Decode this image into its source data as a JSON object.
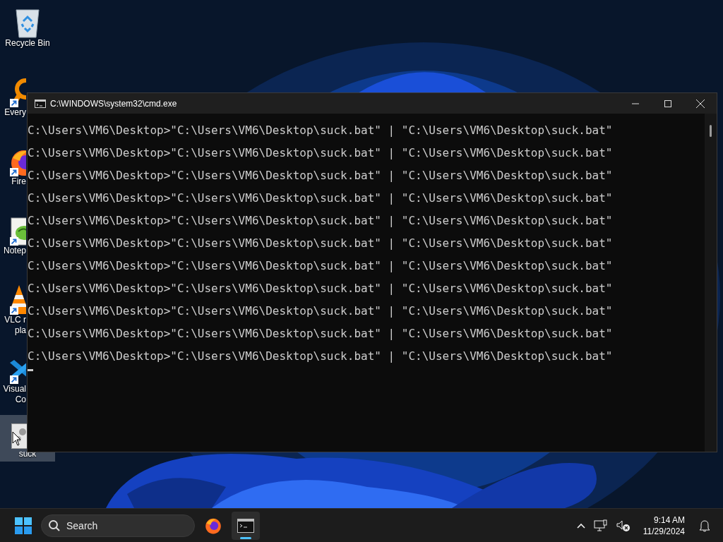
{
  "desktop": {
    "icons": [
      {
        "kind": "recycle",
        "label_lines": [
          "Recycle Bin"
        ],
        "shortcut": false,
        "selected": false
      },
      {
        "kind": "everything",
        "label_lines": [
          "Every"
        ],
        "shortcut": true,
        "selected": false
      },
      {
        "kind": "firefox",
        "label_lines": [
          "Fire"
        ],
        "shortcut": true,
        "selected": false
      },
      {
        "kind": "notepad",
        "label_lines": [
          "Notep"
        ],
        "shortcut": true,
        "selected": false
      },
      {
        "kind": "vlc",
        "label_lines": [
          "VLC r",
          "pla"
        ],
        "shortcut": true,
        "selected": false
      },
      {
        "kind": "vscode",
        "label_lines": [
          "Visual",
          "Co"
        ],
        "shortcut": true,
        "selected": false
      },
      {
        "kind": "batch",
        "label_lines": [
          "suck"
        ],
        "shortcut": false,
        "selected": true
      }
    ]
  },
  "window": {
    "title": "C:\\WINDOWS\\system32\\cmd.exe",
    "lines": [
      "C:\\Users\\VM6\\Desktop>\"C:\\Users\\VM6\\Desktop\\suck.bat\" | \"C:\\Users\\VM6\\Desktop\\suck.bat\"",
      "C:\\Users\\VM6\\Desktop>\"C:\\Users\\VM6\\Desktop\\suck.bat\" | \"C:\\Users\\VM6\\Desktop\\suck.bat\"",
      "C:\\Users\\VM6\\Desktop>\"C:\\Users\\VM6\\Desktop\\suck.bat\" | \"C:\\Users\\VM6\\Desktop\\suck.bat\"",
      "C:\\Users\\VM6\\Desktop>\"C:\\Users\\VM6\\Desktop\\suck.bat\" | \"C:\\Users\\VM6\\Desktop\\suck.bat\"",
      "C:\\Users\\VM6\\Desktop>\"C:\\Users\\VM6\\Desktop\\suck.bat\" | \"C:\\Users\\VM6\\Desktop\\suck.bat\"",
      "C:\\Users\\VM6\\Desktop>\"C:\\Users\\VM6\\Desktop\\suck.bat\" | \"C:\\Users\\VM6\\Desktop\\suck.bat\"",
      "C:\\Users\\VM6\\Desktop>\"C:\\Users\\VM6\\Desktop\\suck.bat\" | \"C:\\Users\\VM6\\Desktop\\suck.bat\"",
      "C:\\Users\\VM6\\Desktop>\"C:\\Users\\VM6\\Desktop\\suck.bat\" | \"C:\\Users\\VM6\\Desktop\\suck.bat\"",
      "C:\\Users\\VM6\\Desktop>\"C:\\Users\\VM6\\Desktop\\suck.bat\" | \"C:\\Users\\VM6\\Desktop\\suck.bat\"",
      "C:\\Users\\VM6\\Desktop>\"C:\\Users\\VM6\\Desktop\\suck.bat\" | \"C:\\Users\\VM6\\Desktop\\suck.bat\"",
      "C:\\Users\\VM6\\Desktop>\"C:\\Users\\VM6\\Desktop\\suck.bat\" | \"C:\\Users\\VM6\\Desktop\\suck.bat\""
    ]
  },
  "taskbar": {
    "search": {
      "placeholder": "Search"
    },
    "apps": [
      {
        "kind": "firefox",
        "selected": false
      },
      {
        "kind": "terminal",
        "selected": true
      }
    ],
    "clock": {
      "time": "9:14 AM",
      "date": "11/29/2024"
    }
  }
}
